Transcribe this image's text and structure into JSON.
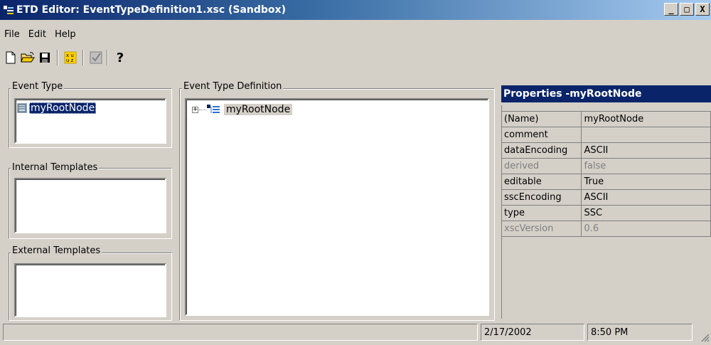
{
  "window": {
    "title": "ETD Editor: EventTypeDefinition1.xsc (Sandbox)",
    "controls": [
      "_",
      "□",
      "X"
    ]
  },
  "menu": [
    {
      "label": "File"
    },
    {
      "label": "Edit"
    },
    {
      "label": "Help"
    }
  ],
  "toolbar": {
    "icons": [
      "new-file-icon",
      "open-folder-icon",
      "save-disk-icon",
      "xsc-convert-icon",
      "check-box-icon",
      "help-question-icon"
    ],
    "help_glyph": "?"
  },
  "event_type": {
    "label": "Event Type",
    "selected_item": "myRootNode"
  },
  "internal_templates": {
    "label": "Internal Templates"
  },
  "external_templates": {
    "label": "External Templates"
  },
  "event_type_definition": {
    "label": "Event Type Definition",
    "tree_root": "myRootNode",
    "expander": "+"
  },
  "properties": {
    "title": "Properties -myRootNode",
    "rows": [
      {
        "key": "(Name)",
        "value": "myRootNode",
        "dim": false
      },
      {
        "key": "comment",
        "value": "",
        "dim": false
      },
      {
        "key": "dataEncoding",
        "value": "ASCII",
        "dim": false
      },
      {
        "key": "derived",
        "value": "false",
        "dim": true
      },
      {
        "key": "editable",
        "value": "True",
        "dim": false
      },
      {
        "key": "sscEncoding",
        "value": "ASCII",
        "dim": false
      },
      {
        "key": "type",
        "value": "SSC",
        "dim": false
      },
      {
        "key": "xscVersion",
        "value": "0.6",
        "dim": true
      }
    ]
  },
  "statusbar": {
    "message": "",
    "date": "2/17/2002",
    "time": "8:50 PM"
  }
}
